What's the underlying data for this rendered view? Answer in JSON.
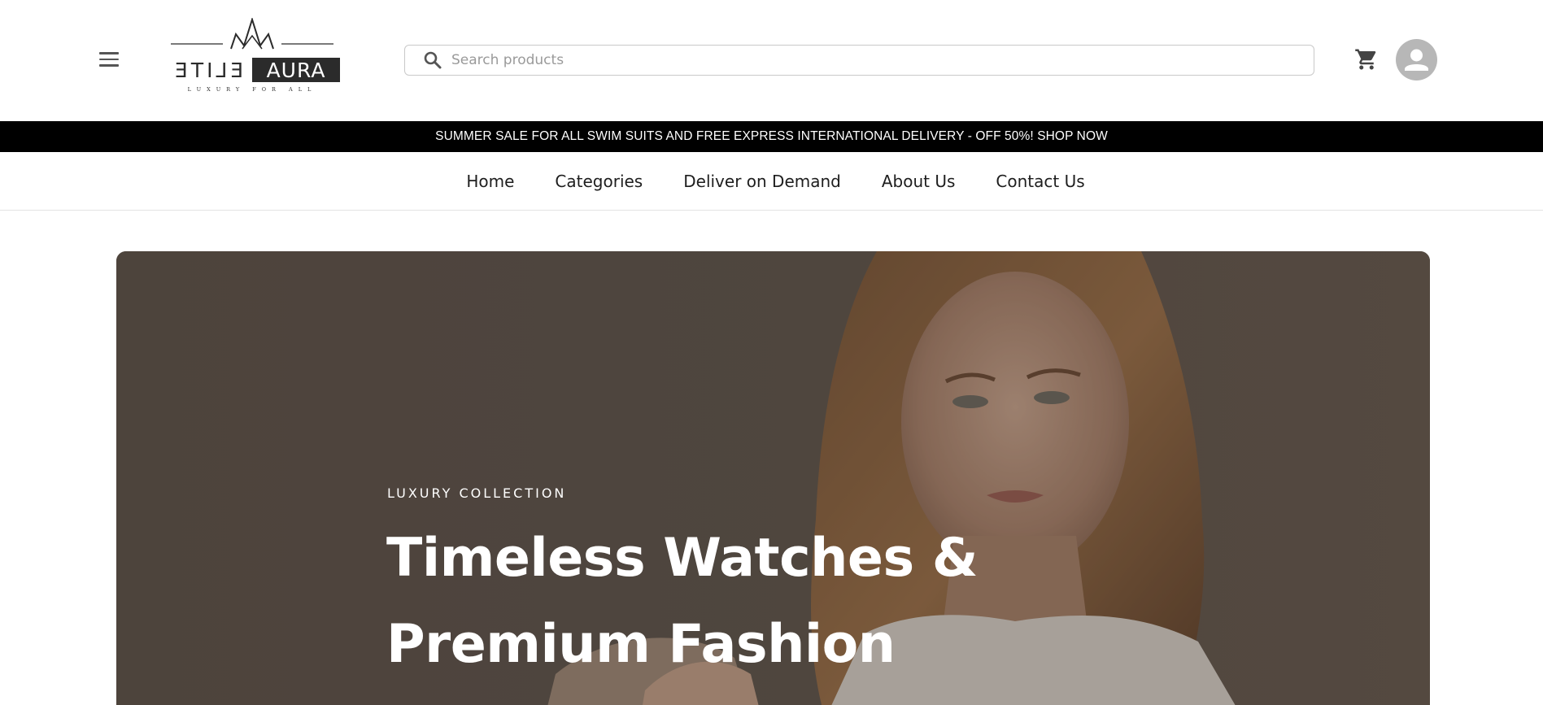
{
  "brand": {
    "name_part1": "ELITE",
    "name_part2": "AURA",
    "tagline": "LUXURY FOR ALL"
  },
  "search": {
    "placeholder": "Search products",
    "value": ""
  },
  "header": {
    "menu_icon": "hamburger-menu-icon",
    "cart_icon": "shopping-cart-icon",
    "account_icon": "user-avatar-icon"
  },
  "promo": {
    "text": "SUMMER SALE FOR ALL SWIM SUITS AND FREE EXPRESS INTERNATIONAL DELIVERY - OFF 50%! SHOP NOW"
  },
  "nav": {
    "items": [
      {
        "label": "Home"
      },
      {
        "label": "Categories"
      },
      {
        "label": "Deliver on Demand"
      },
      {
        "label": "About Us"
      },
      {
        "label": "Contact Us"
      }
    ]
  },
  "hero": {
    "eyebrow": "LUXURY COLLECTION",
    "title_line1": "Timeless Watches &",
    "title_line2": "Premium Fashion"
  },
  "colors": {
    "promo_bg": "#000000",
    "hero_bg": "#5b524a",
    "avatar_bg": "#b7b7b7",
    "logo_dark": "#2b2b2b"
  }
}
